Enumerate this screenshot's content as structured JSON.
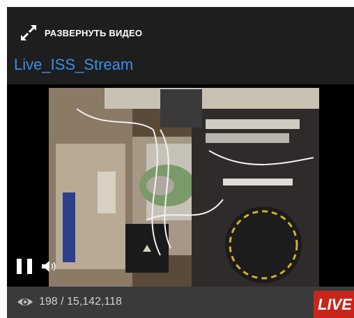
{
  "header": {
    "expand_label": "РАЗВЕРНУТЬ ВИДЕО",
    "title": "Live_ISS_Stream"
  },
  "player": {
    "stats": {
      "count": "198 / 15,142,118"
    },
    "live_badge": "LIVE"
  },
  "colors": {
    "accent": "#3d8ee6",
    "live": "#c8261c",
    "background": "#1b1b1b"
  }
}
